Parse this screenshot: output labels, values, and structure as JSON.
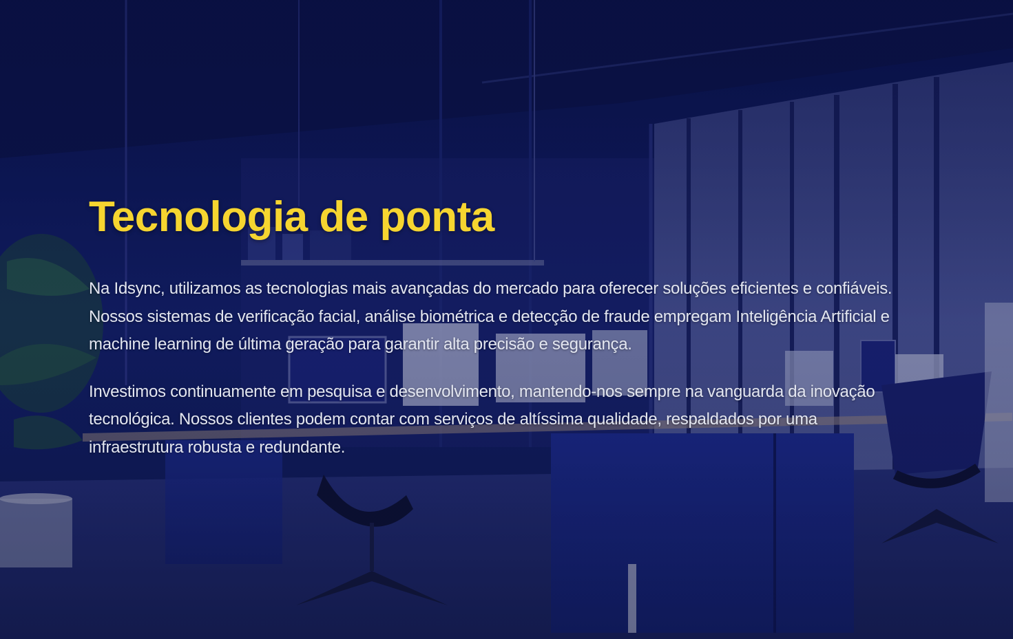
{
  "section": {
    "title": "Tecnologia de ponta",
    "paragraphs": [
      "Na Idsync, utilizamos as tecnologias mais avançadas do mercado para oferecer soluções eficientes e confiáveis. Nossos sistemas de verificação facial, análise biométrica e detecção de fraude empregam Inteligência Artificial e machine learning de última geração para garantir alta precisão e segurança.",
      "Investimos continuamente em pesquisa e desenvolvimento, mantendo-nos sempre na vanguarda da inovação tecnológica. Nossos clientes podem contar com serviços de altíssima qualidade, respaldados por uma infraestrutura robusta e redundante."
    ]
  },
  "colors": {
    "title": "#f6d530",
    "text": "#e3e6f0",
    "background": "#0b1340"
  }
}
